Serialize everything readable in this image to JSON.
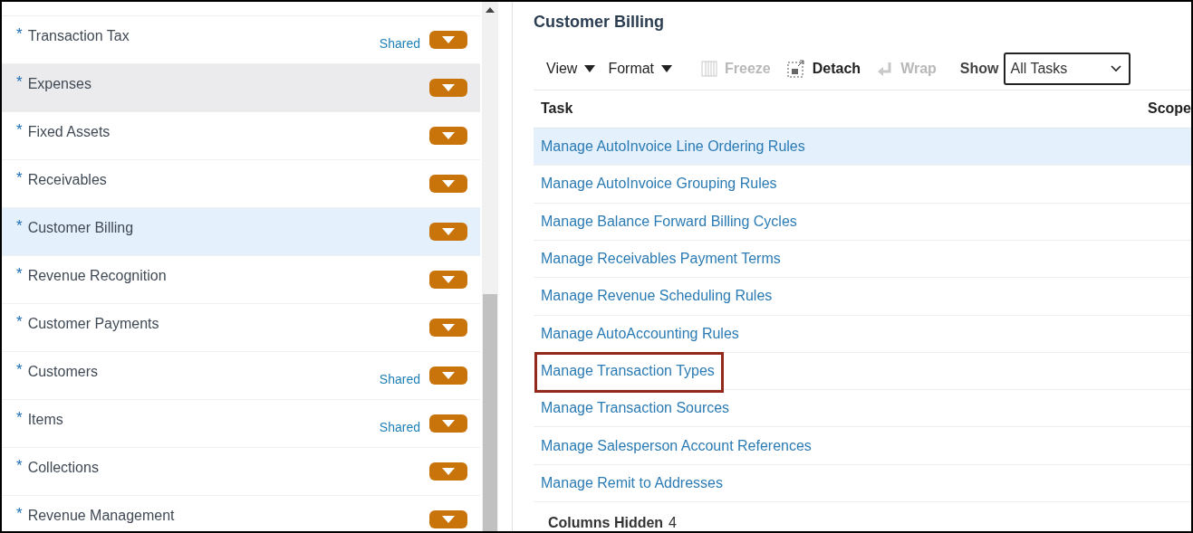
{
  "offerings_list": {
    "items": [
      {
        "label": "Transaction Tax",
        "required": true,
        "shared": "Shared",
        "selected": false,
        "hovered": false
      },
      {
        "label": "Expenses",
        "required": true,
        "selected": false,
        "hovered": true
      },
      {
        "label": "Fixed Assets",
        "required": true,
        "selected": false,
        "hovered": false
      },
      {
        "label": "Receivables",
        "required": true,
        "selected": false,
        "hovered": false
      },
      {
        "label": "Customer Billing",
        "required": true,
        "selected": true,
        "hovered": false
      },
      {
        "label": "Revenue Recognition",
        "required": true,
        "selected": false,
        "hovered": false
      },
      {
        "label": "Customer Payments",
        "required": true,
        "selected": false,
        "hovered": false
      },
      {
        "label": "Customers",
        "required": true,
        "shared": "Shared",
        "selected": false,
        "hovered": false
      },
      {
        "label": "Items",
        "required": true,
        "shared": "Shared",
        "selected": false,
        "hovered": false
      },
      {
        "label": "Collections",
        "required": true,
        "selected": false,
        "hovered": false
      },
      {
        "label": "Revenue Management",
        "required": true,
        "selected": false,
        "hovered": false
      }
    ],
    "required_mark": "*"
  },
  "detail": {
    "title": "Customer Billing",
    "toolbar": [
      {
        "kind": "menu",
        "label": "View",
        "disabled": false
      },
      {
        "kind": "menu",
        "label": "Format",
        "disabled": false
      },
      {
        "kind": "freeze",
        "label": "Freeze",
        "disabled": true
      },
      {
        "kind": "detach",
        "label": "Detach",
        "disabled": false
      },
      {
        "kind": "wrap",
        "label": "Wrap",
        "disabled": true
      },
      {
        "kind": "select",
        "label": "Show",
        "value": "All Tasks",
        "disabled": false
      }
    ],
    "table": {
      "columns": [
        "Task",
        "Scope"
      ],
      "rows": [
        {
          "task": "Manage AutoInvoice Line Ordering Rules",
          "selected": true,
          "highlighted": false
        },
        {
          "task": "Manage AutoInvoice Grouping Rules",
          "selected": false,
          "highlighted": false
        },
        {
          "task": "Manage Balance Forward Billing Cycles",
          "selected": false,
          "highlighted": false
        },
        {
          "task": "Manage Receivables Payment Terms",
          "selected": false,
          "highlighted": false
        },
        {
          "task": "Manage Revenue Scheduling Rules",
          "selected": false,
          "highlighted": false
        },
        {
          "task": "Manage AutoAccounting Rules",
          "selected": false,
          "highlighted": false
        },
        {
          "task": "Manage Transaction Types",
          "selected": false,
          "highlighted": true
        },
        {
          "task": "Manage Transaction Sources",
          "selected": false,
          "highlighted": false
        },
        {
          "task": "Manage Salesperson Account References",
          "selected": false,
          "highlighted": false
        },
        {
          "task": "Manage Remit to Addresses",
          "selected": false,
          "highlighted": false
        }
      ]
    },
    "status": {
      "label": "Columns Hidden",
      "count": "4"
    }
  }
}
